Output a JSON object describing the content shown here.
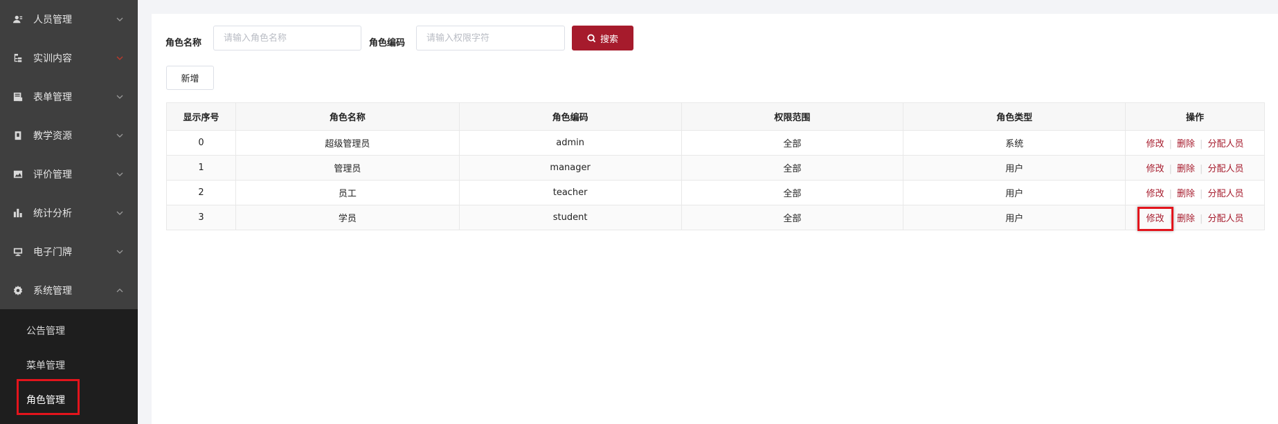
{
  "sidebar": {
    "items": [
      {
        "label": "人员管理",
        "icon": "user-icon",
        "expanded": false
      },
      {
        "label": "实训内容",
        "icon": "tree-icon",
        "expanded": false
      },
      {
        "label": "表单管理",
        "icon": "form-icon",
        "expanded": false
      },
      {
        "label": "教学资源",
        "icon": "book-icon",
        "expanded": false
      },
      {
        "label": "评价管理",
        "icon": "image-icon",
        "expanded": false
      },
      {
        "label": "统计分析",
        "icon": "bar-chart-icon",
        "expanded": false
      },
      {
        "label": "电子门牌",
        "icon": "monitor-icon",
        "expanded": false
      },
      {
        "label": "系统管理",
        "icon": "gear-icon",
        "expanded": true
      }
    ],
    "submenu": [
      {
        "label": "公告管理",
        "active": false
      },
      {
        "label": "菜单管理",
        "active": false
      },
      {
        "label": "角色管理",
        "active": true
      }
    ]
  },
  "search": {
    "role_name_label": "角色名称",
    "role_name_placeholder": "请输入角色名称",
    "role_code_label": "角色编码",
    "role_code_placeholder": "请输入权限字符",
    "search_button": "搜索"
  },
  "toolbar": {
    "add_button": "新增"
  },
  "table": {
    "columns": [
      "显示序号",
      "角色名称",
      "角色编码",
      "权限范围",
      "角色类型",
      "操作"
    ],
    "rows": [
      {
        "order": "0",
        "name": "超级管理员",
        "code": "admin",
        "scope": "全部",
        "type": "系统"
      },
      {
        "order": "1",
        "name": "管理员",
        "code": "manager",
        "scope": "全部",
        "type": "用户"
      },
      {
        "order": "2",
        "name": "员工",
        "code": "teacher",
        "scope": "全部",
        "type": "用户"
      },
      {
        "order": "3",
        "name": "学员",
        "code": "student",
        "scope": "全部",
        "type": "用户"
      }
    ],
    "actions": {
      "edit": "修改",
      "delete": "删除",
      "assign": "分配人员"
    }
  },
  "colors": {
    "accent": "#a61b2c",
    "sidebar_bg": "#3f3f3f",
    "submenu_bg": "#1e1e1e",
    "highlight": "#e3141c"
  }
}
